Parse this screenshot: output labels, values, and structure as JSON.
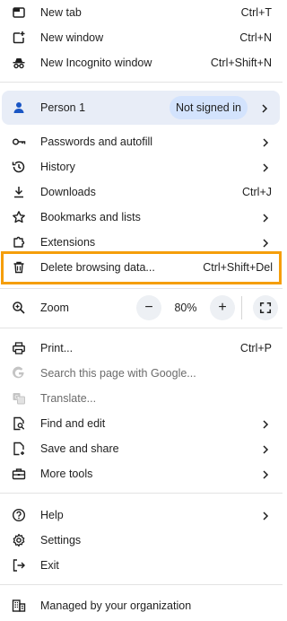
{
  "menu": {
    "new_tab": {
      "label": "New tab",
      "shortcut": "Ctrl+T"
    },
    "new_window": {
      "label": "New window",
      "shortcut": "Ctrl+N"
    },
    "new_incognito": {
      "label": "New Incognito window",
      "shortcut": "Ctrl+Shift+N"
    },
    "profile": {
      "name": "Person 1",
      "status": "Not signed in"
    },
    "passwords": {
      "label": "Passwords and autofill"
    },
    "history": {
      "label": "History"
    },
    "downloads": {
      "label": "Downloads",
      "shortcut": "Ctrl+J"
    },
    "bookmarks": {
      "label": "Bookmarks and lists"
    },
    "extensions": {
      "label": "Extensions"
    },
    "delete_data": {
      "label": "Delete browsing data...",
      "shortcut": "Ctrl+Shift+Del"
    },
    "zoom": {
      "label": "Zoom",
      "value": "80%",
      "minus": "−",
      "plus": "+"
    },
    "print": {
      "label": "Print...",
      "shortcut": "Ctrl+P"
    },
    "search_page": {
      "label": "Search this page with Google..."
    },
    "translate": {
      "label": "Translate..."
    },
    "find_edit": {
      "label": "Find and edit"
    },
    "save_share": {
      "label": "Save and share"
    },
    "more_tools": {
      "label": "More tools"
    },
    "help": {
      "label": "Help"
    },
    "settings": {
      "label": "Settings"
    },
    "exit": {
      "label": "Exit"
    },
    "managed": {
      "label": "Managed by your organization"
    }
  },
  "colors": {
    "highlight": "#f59e0b",
    "profile_bg": "#e8edf7",
    "badge_bg": "#d3e3fd"
  }
}
